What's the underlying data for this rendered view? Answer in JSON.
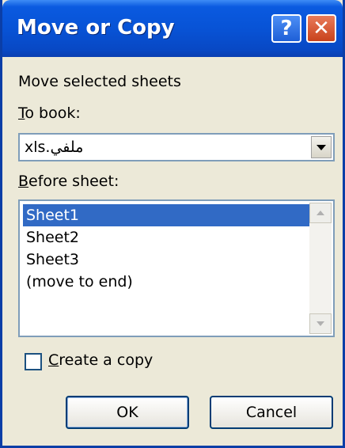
{
  "window": {
    "title": "Move or Copy",
    "help_glyph": "?",
    "close_glyph": "✕"
  },
  "dialog": {
    "heading": "Move selected sheets",
    "to_book_label": "To book:",
    "to_book_value": "xls.ملفي",
    "before_sheet_label": "Before sheet:",
    "sheets": [
      "Sheet1",
      "Sheet2",
      "Sheet3",
      "(move to end)"
    ],
    "selected_index": 0,
    "create_copy_label": "Create a copy",
    "create_copy_checked": false,
    "ok_label": "OK",
    "cancel_label": "Cancel"
  },
  "colors": {
    "titlebar": "#0853d6",
    "selection": "#316ac5",
    "close_button": "#c8421c"
  },
  "icons": {
    "help": "help-icon",
    "close": "close-icon",
    "dropdown": "chevron-down-icon"
  }
}
